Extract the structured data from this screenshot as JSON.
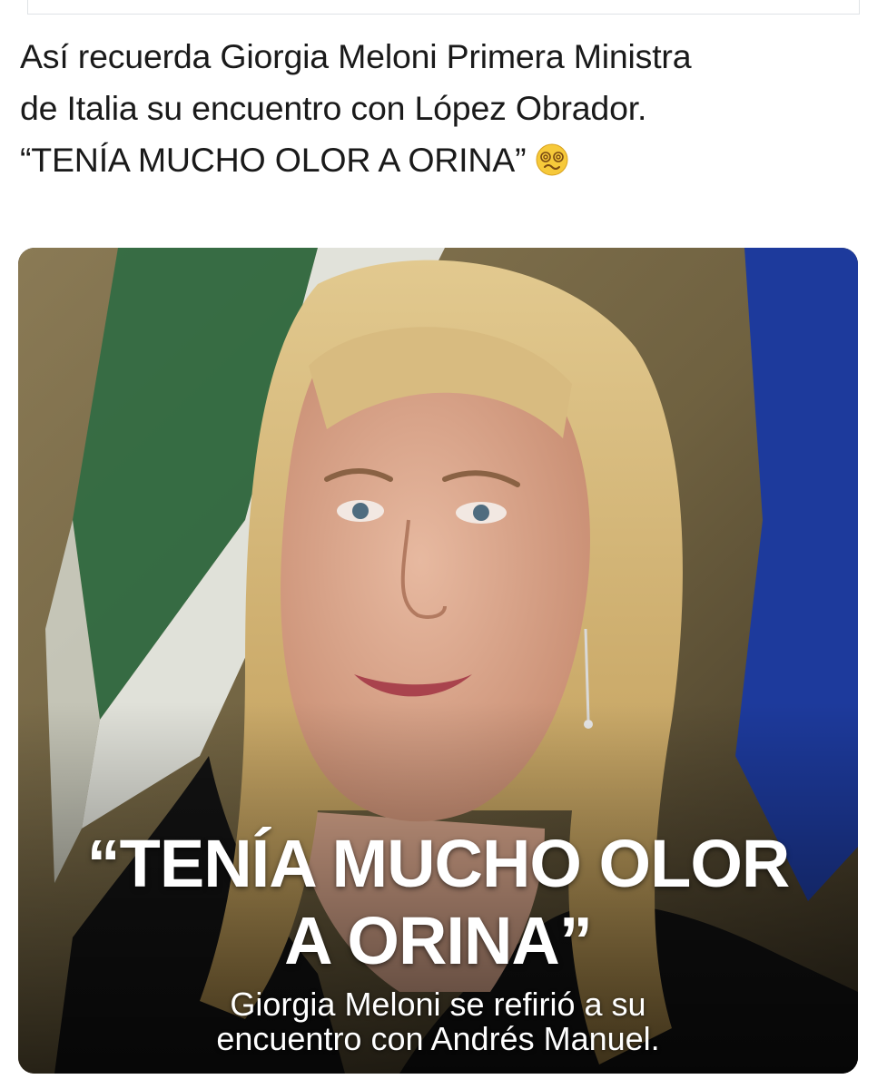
{
  "post": {
    "lines": [
      "Así recuerda Giorgia Meloni Primera Ministra",
      "de Italia su encuentro con López Obrador.",
      "“TENÍA MUCHO OLOR A ORINA”"
    ],
    "emoji": "woozy-face-icon"
  },
  "photo": {
    "quote_lines": [
      "“TENÍA MUCHO OLOR",
      "A ORINA”"
    ],
    "caption_lines": [
      "Giorgia Meloni se refirió a su",
      "encuentro con Andrés Manuel."
    ]
  },
  "colors": {
    "text": "#1a1a1a",
    "flag_green": "#2f6b43",
    "flag_white": "#e9ece6",
    "eu_blue": "#1d3a9c",
    "overlay_text": "#ffffff"
  }
}
